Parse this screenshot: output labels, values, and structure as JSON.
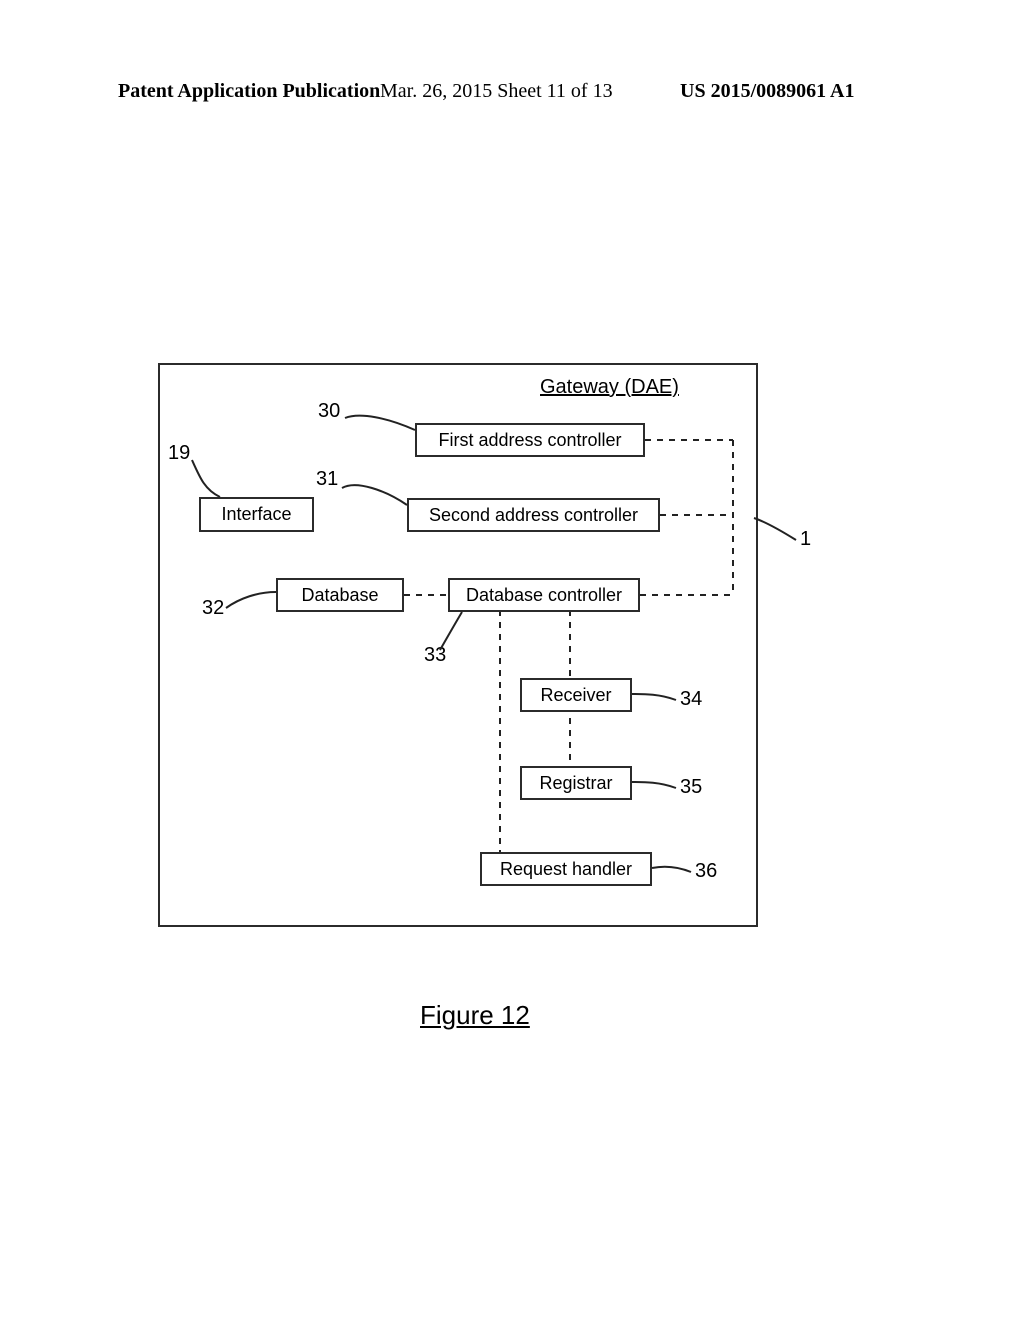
{
  "header": {
    "left": "Patent Application Publication",
    "mid": "Mar. 26, 2015  Sheet 11 of 13",
    "right": "US 2015/0089061 A1"
  },
  "diagram": {
    "title": "Gateway (DAE)",
    "interface": "Interface",
    "first_addr": "First address controller",
    "second_addr": "Second address controller",
    "database": "Database",
    "db_ctrl": "Database controller",
    "receiver": "Receiver",
    "registrar": "Registrar",
    "request_handler": "Request handler"
  },
  "labels": {
    "n1": "1",
    "n19": "19",
    "n30": "30",
    "n31": "31",
    "n32": "32",
    "n33": "33",
    "n34": "34",
    "n35": "35",
    "n36": "36"
  },
  "figure": "Figure 12"
}
